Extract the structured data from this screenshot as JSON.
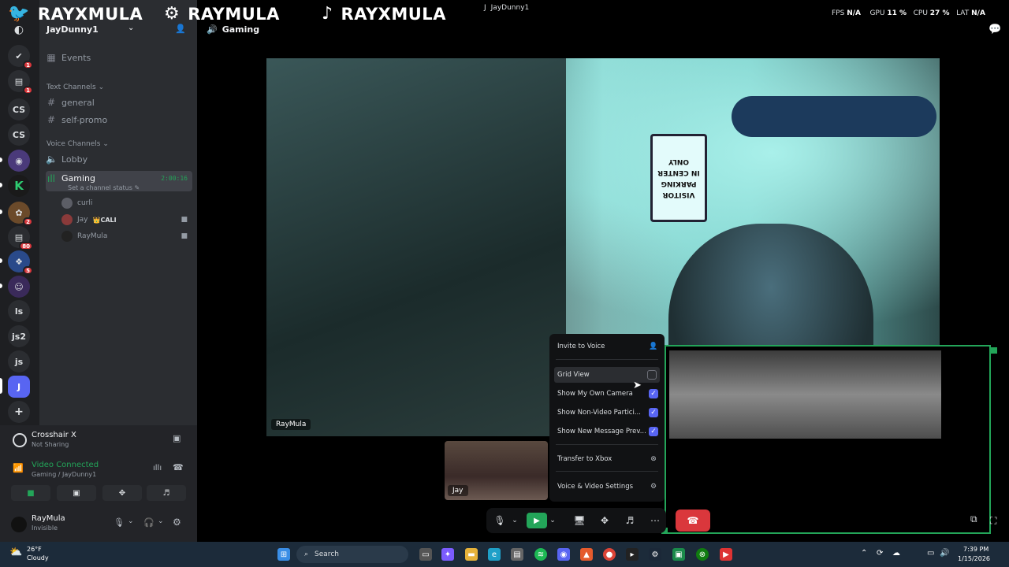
{
  "overlay": {
    "brands": [
      {
        "icon": "twitter-icon",
        "glyph": "🐦",
        "label": "RAYXMULA"
      },
      {
        "icon": "steam-icon",
        "glyph": "⚙",
        "label": "RAYMULA"
      },
      {
        "icon": "tiktok-icon",
        "glyph": "♪",
        "label": "RAYXMULA"
      }
    ],
    "window_user": "JayDunny1",
    "stats": {
      "fps_label": "FPS",
      "fps": "N/A",
      "gpu_label": "GPU",
      "gpu": "11 %",
      "cpu_label": "CPU",
      "cpu": "27 %",
      "lat_label": "LAT",
      "lat": "N/A"
    }
  },
  "rail": {
    "servers": [
      {
        "label": "✔",
        "badge": "1"
      },
      {
        "label": "▤",
        "badge": "1"
      },
      {
        "label": "CS",
        "badge": ""
      },
      {
        "label": "CS",
        "badge": ""
      },
      {
        "label": "◉",
        "badge": ""
      },
      {
        "label": "K",
        "badge": ""
      },
      {
        "label": "✿",
        "badge": "2"
      },
      {
        "label": "▤",
        "badge": "80"
      },
      {
        "label": "❖",
        "badge": "5"
      },
      {
        "label": "☺",
        "badge": ""
      },
      {
        "label": "ls",
        "badge": ""
      },
      {
        "label": "js2",
        "badge": ""
      },
      {
        "label": "js",
        "badge": ""
      },
      {
        "label": "J",
        "badge": ""
      },
      {
        "label": "+",
        "badge": ""
      }
    ]
  },
  "sidebar": {
    "guild_name": "JayDunny1",
    "events": "Events",
    "text_category": "Text Channels",
    "text_channels": [
      "general",
      "self-promo"
    ],
    "voice_category": "Voice Channels",
    "voice_channels": [
      "Lobby",
      "Gaming"
    ],
    "active_timer": "2:00:16",
    "channel_status_placeholder": "Set a channel status",
    "members": [
      {
        "name": "curli",
        "tag": "",
        "camera": false
      },
      {
        "name": "Jay",
        "tag": "👑CALI",
        "camera": true
      },
      {
        "name": "RayMula",
        "tag": "",
        "camera": true
      }
    ]
  },
  "activity": {
    "title": "Crosshair X",
    "subtitle": "Not Sharing"
  },
  "voice_status": {
    "title": "Video Connected",
    "subtitle": "Gaming / JayDunny1"
  },
  "user": {
    "name": "RayMula",
    "status": "Invisible"
  },
  "main": {
    "channel_title": "Gaming",
    "main_video_name": "RayMula",
    "sign_lines": [
      "VISITOR",
      "PARKING",
      "IN CENTER",
      "ONLY"
    ],
    "tile_jay": "Jay",
    "tile_raymula": "ayMula"
  },
  "menu": {
    "items": [
      {
        "label": "Invite to Voice",
        "kind": "icon",
        "icon": "add-user-icon",
        "glyph": "👤"
      },
      {
        "label": "Grid View",
        "kind": "check",
        "checked": false
      },
      {
        "label": "Show My Own Camera",
        "kind": "check",
        "checked": true
      },
      {
        "label": "Show Non-Video Partici...",
        "kind": "check",
        "checked": true
      },
      {
        "label": "Show New Message Prev...",
        "kind": "check",
        "checked": true
      },
      {
        "label": "Transfer to Xbox",
        "kind": "icon",
        "icon": "xbox-icon",
        "glyph": "⊗"
      },
      {
        "label": "Voice & Video Settings",
        "kind": "icon",
        "icon": "gear-icon",
        "glyph": "⚙"
      }
    ]
  },
  "taskbar": {
    "weather_temp": "26°F",
    "weather_desc": "Cloudy",
    "search_placeholder": "Search",
    "time": "7:39 PM",
    "date": "1/15/2026"
  },
  "colors": {
    "accent": "#5865f2",
    "green": "#23a559",
    "red": "#da373c"
  }
}
